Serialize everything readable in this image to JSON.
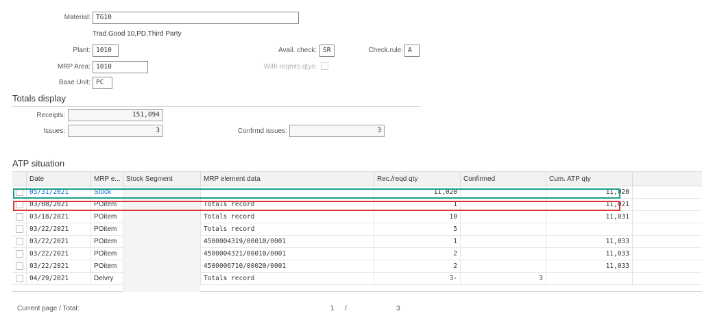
{
  "header": {
    "material_label": "Material:",
    "material_value": "TG10",
    "material_desc": "Trad.Good 10,PD,Third Party",
    "plant_label": "Plant:",
    "plant_value": "1010",
    "avail_check_label": "Avail. check:",
    "avail_check_value": "SR",
    "check_rule_label": "Check.rule:",
    "check_rule_value": "A",
    "mrp_area_label": "MRP Area:",
    "mrp_area_value": "1010",
    "with_reqmts_label": "With reqmts qtys:",
    "base_unit_label": "Base Unit:",
    "base_unit_value": "PC"
  },
  "totals": {
    "title": "Totals display",
    "receipts_label": "Receipts:",
    "receipts_value": "151,094",
    "issues_label": "Issues:",
    "issues_value": "3",
    "confirmed_issues_label": "Confrmd issues:",
    "confirmed_issues_value": "3"
  },
  "atp": {
    "title": "ATP situation",
    "columns": [
      "Date",
      "MRP e...",
      "Stock Segment",
      "MRP element data",
      "Rec./reqd qty",
      "Confirmed",
      "Cum. ATP qty"
    ],
    "rows": [
      {
        "date": "05/31/2021",
        "mrp_element": "Stock",
        "segment": "",
        "element_data": "",
        "qty": "11,020",
        "confirmed": "",
        "cum_atp": "11,020"
      },
      {
        "date": "03/08/2021",
        "mrp_element": "POitem",
        "segment": "",
        "element_data": "Totals record",
        "qty": "1",
        "confirmed": "",
        "cum_atp": "11,021"
      },
      {
        "date": "03/18/2021",
        "mrp_element": "POitem",
        "segment": "",
        "element_data": "Totals record",
        "qty": "10",
        "confirmed": "",
        "cum_atp": "11,031"
      },
      {
        "date": "03/22/2021",
        "mrp_element": "POitem",
        "segment": "",
        "element_data": "Totals record",
        "qty": "5",
        "confirmed": "",
        "cum_atp": ""
      },
      {
        "date": "03/22/2021",
        "mrp_element": "POitem",
        "segment": "",
        "element_data": "4500004319/00010/0001",
        "qty": "1",
        "confirmed": "",
        "cum_atp": "11,033"
      },
      {
        "date": "03/22/2021",
        "mrp_element": "POitem",
        "segment": "",
        "element_data": "4500004321/00010/0001",
        "qty": "2",
        "confirmed": "",
        "cum_atp": "11,033"
      },
      {
        "date": "03/22/2021",
        "mrp_element": "POitem",
        "segment": "",
        "element_data": "4500006710/00020/0001",
        "qty": "2",
        "confirmed": "",
        "cum_atp": "11,033"
      },
      {
        "date": "04/29/2021",
        "mrp_element": "Delvry",
        "segment": "",
        "element_data": "Totals record",
        "qty": "3-",
        "confirmed": "3",
        "cum_atp": ""
      }
    ]
  },
  "footer": {
    "page_label": "Current page / Total:",
    "current_page": "1",
    "separator": "/",
    "total_pages": "3"
  },
  "colors": {
    "highlight_green": "#1a9e8a",
    "highlight_red": "#d9363e",
    "link": "#0a6ed1"
  }
}
